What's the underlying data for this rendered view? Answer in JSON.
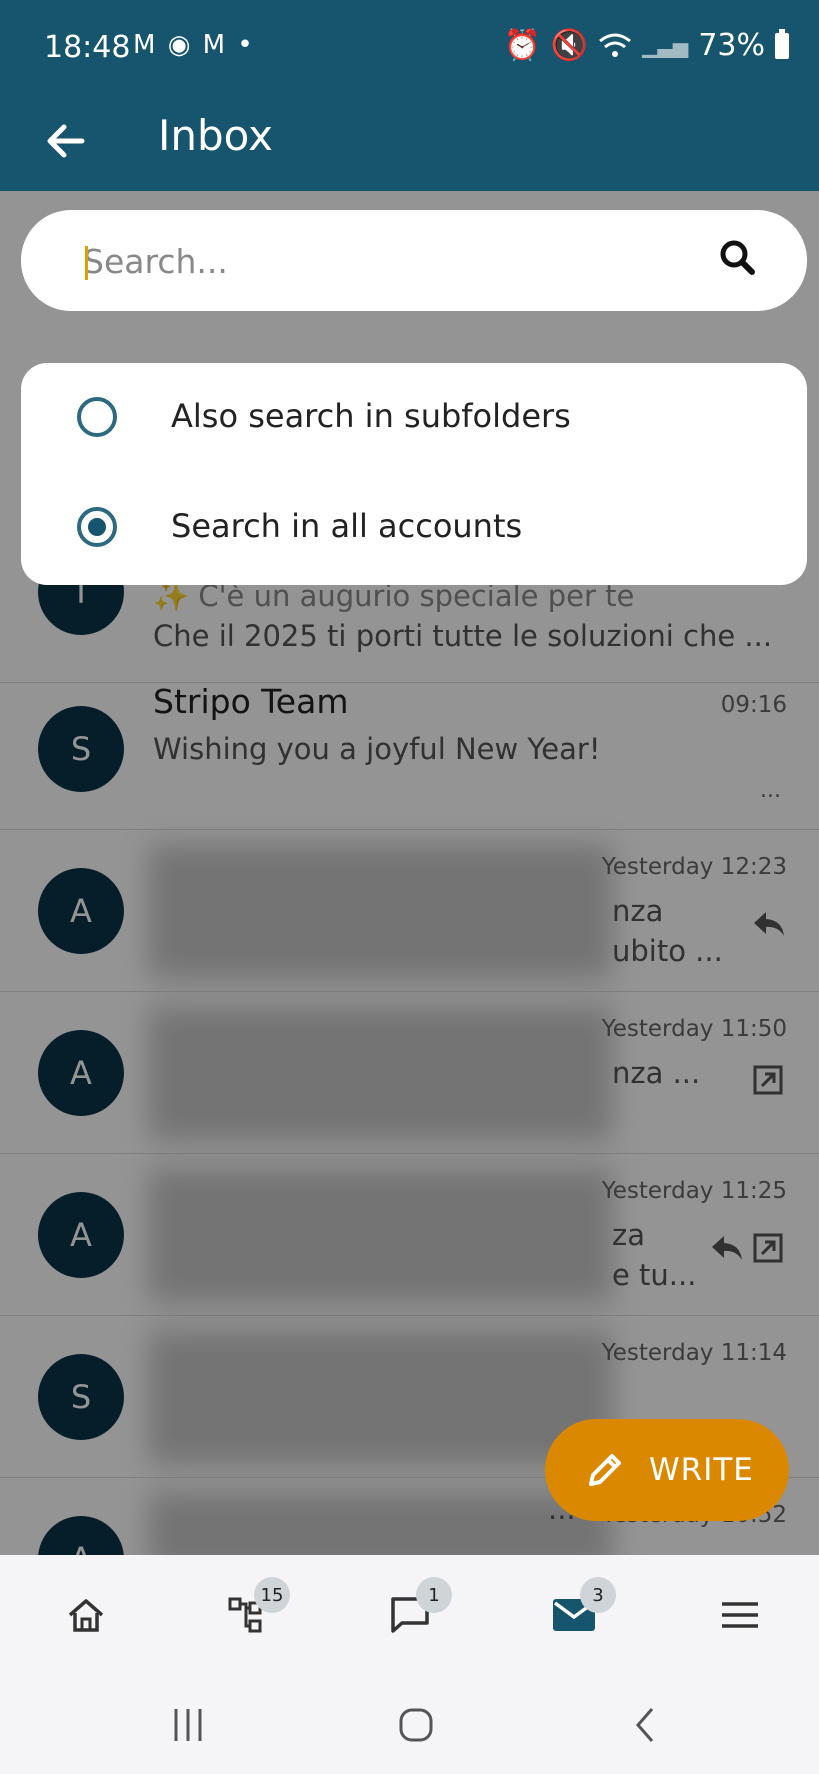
{
  "status_bar": {
    "time": "18:48",
    "notifications": "M ◉ M •",
    "battery": "73%"
  },
  "app_bar": {
    "title": "Inbox"
  },
  "search": {
    "placeholder": "Search..."
  },
  "search_options": [
    {
      "label": "Also search in subfolders",
      "checked": false
    },
    {
      "label": "Search in all accounts",
      "checked": true
    }
  ],
  "messages": [
    {
      "initial": "T",
      "sender": "",
      "time": "",
      "subject": "✨ C'è un augurio speciale per te",
      "preview": "Che il 2025 ti porti tutte le soluzioni che ..."
    },
    {
      "initial": "S",
      "sender": "Stripo Team",
      "time": "09:16",
      "preview": "Wishing you a joyful New Year!",
      "ellipsis": "..."
    },
    {
      "initial": "A",
      "time": "Yesterday 12:23",
      "snippet1": "nza",
      "snippet2": "ubito ...",
      "icons": [
        "reply-icon"
      ]
    },
    {
      "initial": "A",
      "time": "Yesterday 11:50",
      "snippet1": "nza ...",
      "icons": [
        "open-external-icon"
      ]
    },
    {
      "initial": "A",
      "time": "Yesterday 11:25",
      "snippet1": "za",
      "snippet2": "e tu...",
      "icons": [
        "reply-icon",
        "open-external-icon"
      ]
    },
    {
      "initial": "S",
      "time": "Yesterday 11:14"
    },
    {
      "initial": "A",
      "time": "Yesterday 10:52",
      "snippet1": "..."
    }
  ],
  "fab": {
    "label": "WRITE"
  },
  "bottom_nav": [
    {
      "icon": "home-icon",
      "badge": ""
    },
    {
      "icon": "folder-tree-icon",
      "badge": "15"
    },
    {
      "icon": "chat-icon",
      "badge": "1"
    },
    {
      "icon": "mail-icon",
      "badge": "3"
    },
    {
      "icon": "menu-icon",
      "badge": ""
    }
  ],
  "colors": {
    "primary": "#17546d",
    "accent": "#da8800",
    "avatar": "#0c3447"
  }
}
